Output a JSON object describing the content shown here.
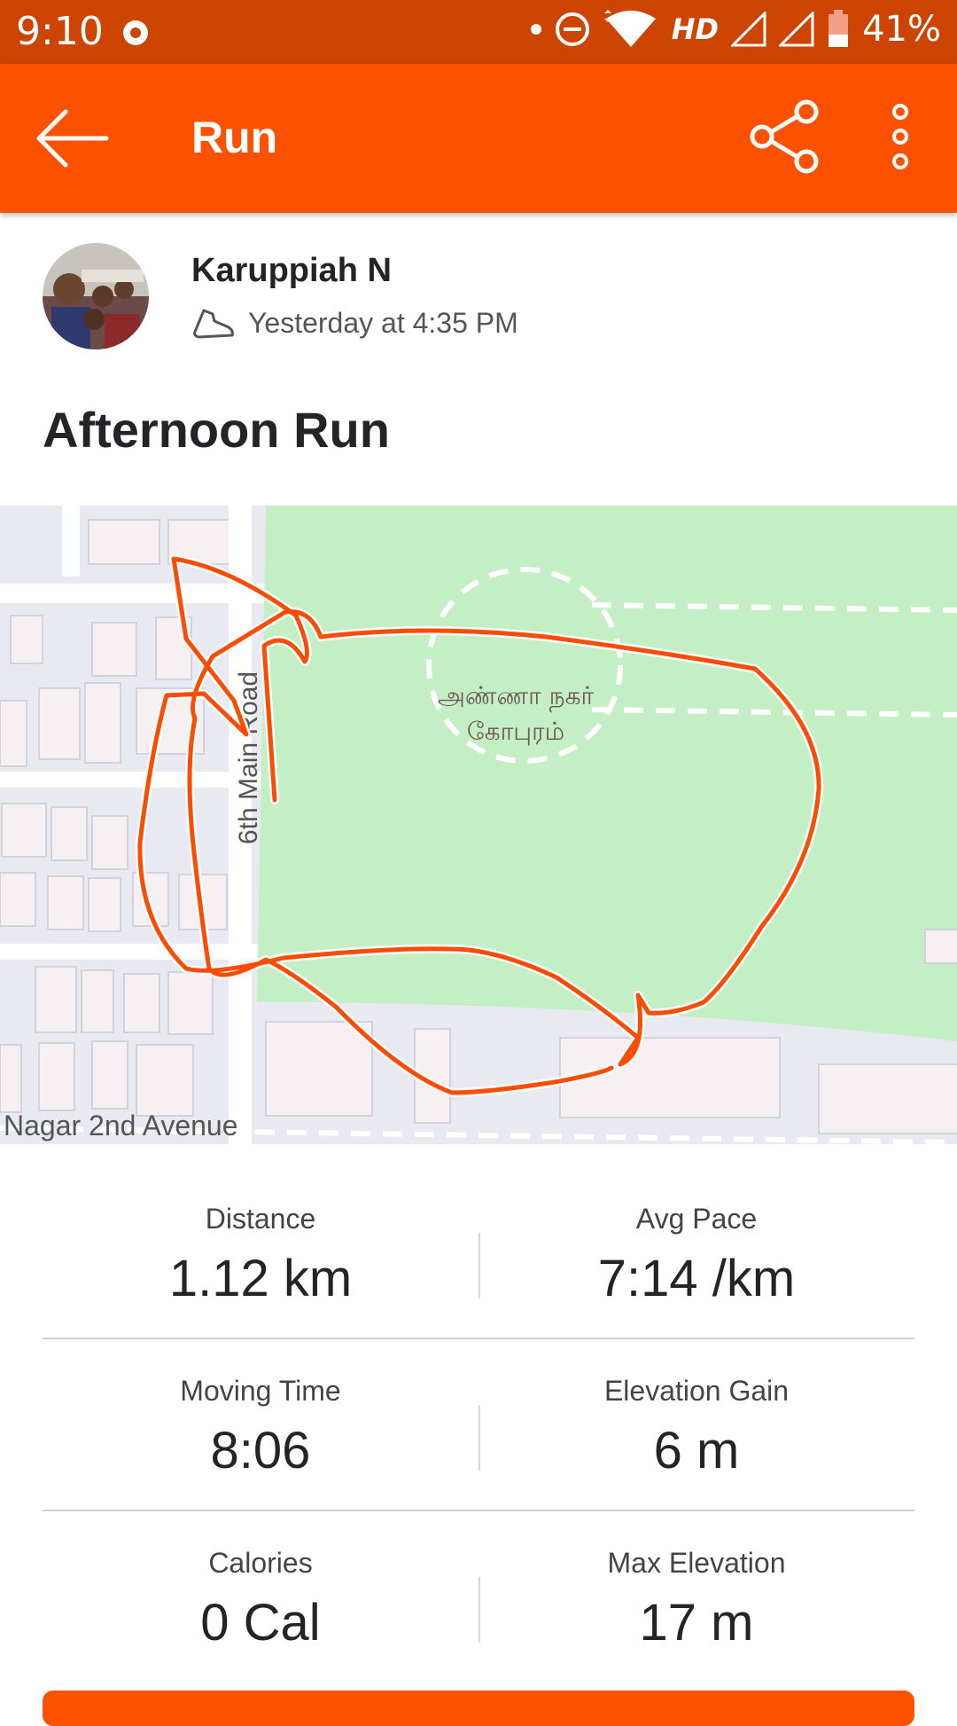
{
  "status_bar": {
    "time": "9:10",
    "network": "HD",
    "battery": "41%"
  },
  "app_bar": {
    "title": "Run"
  },
  "athlete": {
    "name": "Karuppiah N",
    "timestamp": "Yesterday at 4:35 PM"
  },
  "activity": {
    "title": "Afternoon Run"
  },
  "map": {
    "park_label_line1": "அண்ணா நகர்",
    "park_label_line2": "கோபுரம்",
    "road_label": "6th Main Road",
    "street_label": "Nagar 2nd Avenue"
  },
  "stats": [
    {
      "label": "Distance",
      "value": "1.12 km"
    },
    {
      "label": "Avg Pace",
      "value": "7:14 /km"
    },
    {
      "label": "Moving Time",
      "value": "8:06"
    },
    {
      "label": "Elevation Gain",
      "value": "6 m"
    },
    {
      "label": "Calories",
      "value": "0 Cal"
    },
    {
      "label": "Max Elevation",
      "value": "17 m"
    }
  ],
  "colors": {
    "brand": "#FC5200",
    "status_bar": "#CC4400",
    "park": "#C4EFC4",
    "route": "#FC4C02"
  }
}
